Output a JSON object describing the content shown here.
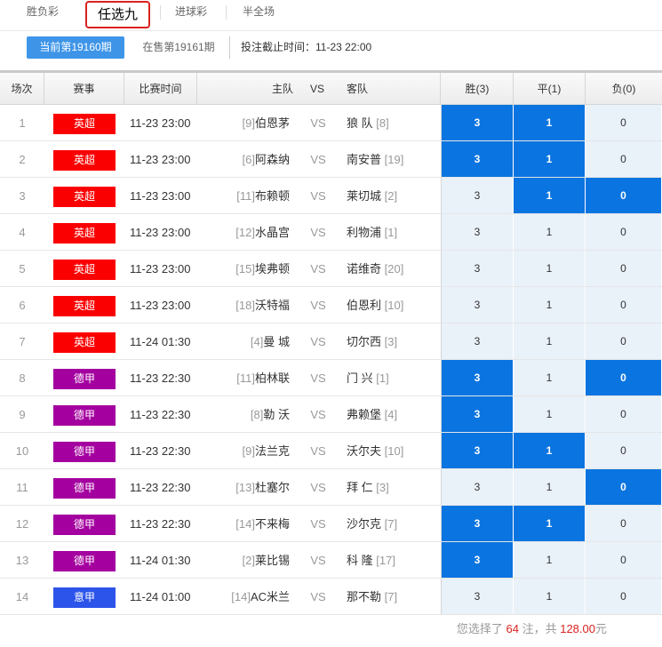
{
  "tabs": [
    {
      "label": "胜负彩",
      "active": false
    },
    {
      "label": "任选九",
      "active": true
    },
    {
      "label": "进球彩",
      "active": false
    },
    {
      "label": "半全场",
      "active": false
    }
  ],
  "period": {
    "current": "当前第19160期",
    "on_sale": "在售第19161期",
    "deadline": "投注截止时间：11-23 22:00"
  },
  "headers": {
    "no": "场次",
    "league": "赛事",
    "time": "比赛时间",
    "home": "主队",
    "vs": "VS",
    "away": "客队",
    "win": "胜(3)",
    "draw": "平(1)",
    "lose": "负(0)"
  },
  "colors": {
    "epl": "#fb0000",
    "bundesliga": "#a4009f",
    "seriea": "#2c54ea",
    "selected": "#0a74e0"
  },
  "matches": [
    {
      "no": "1",
      "league": "英超",
      "lc": "#fb0000",
      "time": "11-23 23:00",
      "home_rank": "[9]",
      "home": "伯恩茅",
      "vs": "VS",
      "away": "狼 队",
      "away_rank": "[8]",
      "w": "3",
      "d": "1",
      "l": "0",
      "sel": [
        true,
        true,
        false
      ]
    },
    {
      "no": "2",
      "league": "英超",
      "lc": "#fb0000",
      "time": "11-23 23:00",
      "home_rank": "[6]",
      "home": "阿森纳",
      "vs": "VS",
      "away": "南安普",
      "away_rank": "[19]",
      "w": "3",
      "d": "1",
      "l": "0",
      "sel": [
        true,
        true,
        false
      ]
    },
    {
      "no": "3",
      "league": "英超",
      "lc": "#fb0000",
      "time": "11-23 23:00",
      "home_rank": "[11]",
      "home": "布赖顿",
      "vs": "VS",
      "away": "莱切城",
      "away_rank": "[2]",
      "w": "3",
      "d": "1",
      "l": "0",
      "sel": [
        false,
        true,
        true
      ]
    },
    {
      "no": "4",
      "league": "英超",
      "lc": "#fb0000",
      "time": "11-23 23:00",
      "home_rank": "[12]",
      "home": "水晶宫",
      "vs": "VS",
      "away": "利物浦",
      "away_rank": "[1]",
      "w": "3",
      "d": "1",
      "l": "0",
      "sel": [
        false,
        false,
        false
      ]
    },
    {
      "no": "5",
      "league": "英超",
      "lc": "#fb0000",
      "time": "11-23 23:00",
      "home_rank": "[15]",
      "home": "埃弗顿",
      "vs": "VS",
      "away": "诺维奇",
      "away_rank": "[20]",
      "w": "3",
      "d": "1",
      "l": "0",
      "sel": [
        false,
        false,
        false
      ]
    },
    {
      "no": "6",
      "league": "英超",
      "lc": "#fb0000",
      "time": "11-23 23:00",
      "home_rank": "[18]",
      "home": "沃特福",
      "vs": "VS",
      "away": "伯恩利",
      "away_rank": "[10]",
      "w": "3",
      "d": "1",
      "l": "0",
      "sel": [
        false,
        false,
        false
      ]
    },
    {
      "no": "7",
      "league": "英超",
      "lc": "#fb0000",
      "time": "11-24 01:30",
      "home_rank": "[4]",
      "home": "曼 城",
      "vs": "VS",
      "away": "切尔西",
      "away_rank": "[3]",
      "w": "3",
      "d": "1",
      "l": "0",
      "sel": [
        false,
        false,
        false
      ]
    },
    {
      "no": "8",
      "league": "德甲",
      "lc": "#a4009f",
      "time": "11-23 22:30",
      "home_rank": "[11]",
      "home": "柏林联",
      "vs": "VS",
      "away": "门 兴",
      "away_rank": "[1]",
      "w": "3",
      "d": "1",
      "l": "0",
      "sel": [
        true,
        false,
        true
      ]
    },
    {
      "no": "9",
      "league": "德甲",
      "lc": "#a4009f",
      "time": "11-23 22:30",
      "home_rank": "[8]",
      "home": "勒 沃",
      "vs": "VS",
      "away": "弗赖堡",
      "away_rank": "[4]",
      "w": "3",
      "d": "1",
      "l": "0",
      "sel": [
        true,
        false,
        false
      ]
    },
    {
      "no": "10",
      "league": "德甲",
      "lc": "#a4009f",
      "time": "11-23 22:30",
      "home_rank": "[9]",
      "home": "法兰克",
      "vs": "VS",
      "away": "沃尔夫",
      "away_rank": "[10]",
      "w": "3",
      "d": "1",
      "l": "0",
      "sel": [
        true,
        true,
        false
      ]
    },
    {
      "no": "11",
      "league": "德甲",
      "lc": "#a4009f",
      "time": "11-23 22:30",
      "home_rank": "[13]",
      "home": "杜塞尔",
      "vs": "VS",
      "away": "拜 仁",
      "away_rank": "[3]",
      "w": "3",
      "d": "1",
      "l": "0",
      "sel": [
        false,
        false,
        true
      ]
    },
    {
      "no": "12",
      "league": "德甲",
      "lc": "#a4009f",
      "time": "11-23 22:30",
      "home_rank": "[14]",
      "home": "不来梅",
      "vs": "VS",
      "away": "沙尔克",
      "away_rank": "[7]",
      "w": "3",
      "d": "1",
      "l": "0",
      "sel": [
        true,
        true,
        false
      ]
    },
    {
      "no": "13",
      "league": "德甲",
      "lc": "#a4009f",
      "time": "11-24 01:30",
      "home_rank": "[2]",
      "home": "莱比锡",
      "vs": "VS",
      "away": "科 隆",
      "away_rank": "[17]",
      "w": "3",
      "d": "1",
      "l": "0",
      "sel": [
        true,
        false,
        false
      ]
    },
    {
      "no": "14",
      "league": "意甲",
      "lc": "#2c54ea",
      "time": "11-24 01:00",
      "home_rank": "[14]",
      "home": "AC米兰",
      "vs": "VS",
      "away": "那不勒",
      "away_rank": "[7]",
      "w": "3",
      "d": "1",
      "l": "0",
      "sel": [
        false,
        false,
        false
      ]
    }
  ],
  "summary": {
    "prefix": "您选择了",
    "bets": "64",
    "mid": "注，共",
    "amount": "128.00",
    "suffix": "元"
  }
}
